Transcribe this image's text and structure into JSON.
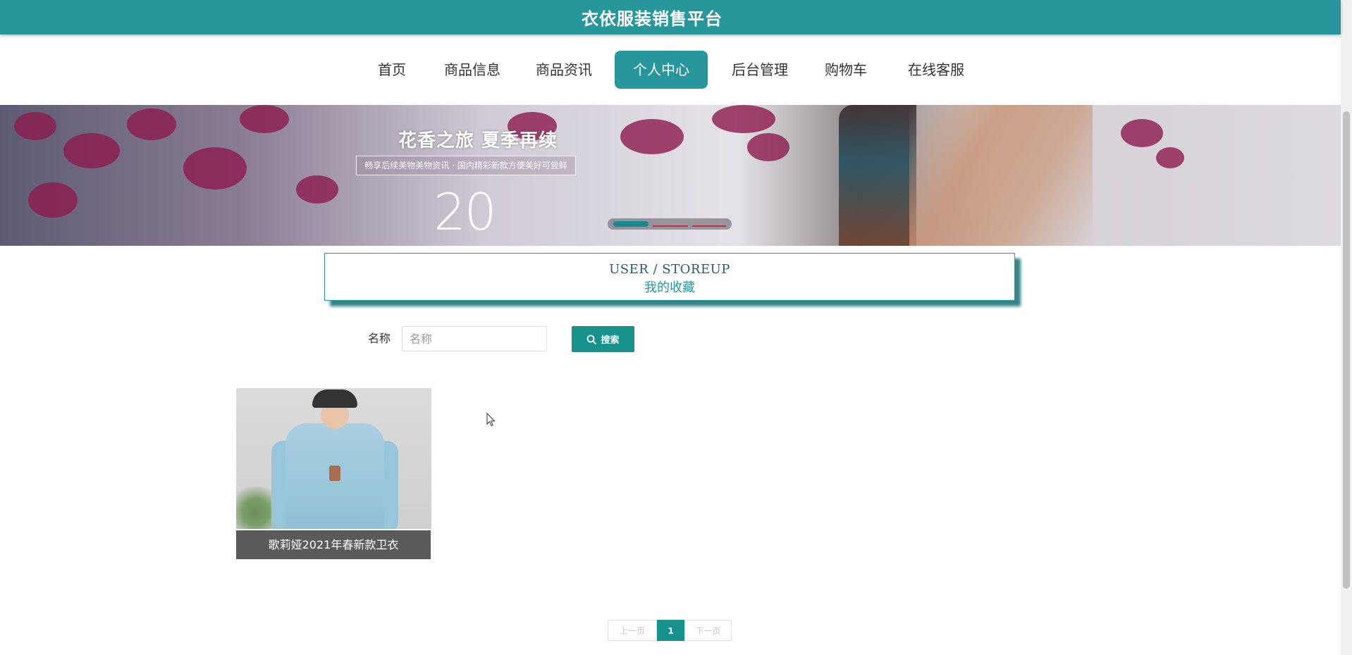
{
  "header": {
    "site_title": "衣依服装销售平台",
    "bg_color": "#27979c"
  },
  "nav": {
    "items": [
      {
        "label": "首页"
      },
      {
        "label": "商品信息"
      },
      {
        "label": "商品资讯"
      },
      {
        "label": "个人中心",
        "active": true
      },
      {
        "label": "后台管理"
      },
      {
        "label": "购物车"
      },
      {
        "label": "在线客服"
      }
    ]
  },
  "banner": {
    "headline": "花香之旅 夏季再续",
    "subline": "畅享后续美物美物资讯 · 国内精彩新款方便美好可尝鲜",
    "big_text": "20",
    "carousel": {
      "count": 3,
      "active_index": 0
    }
  },
  "section": {
    "en_title": "USER / STOREUP",
    "cn_title": "我的收藏"
  },
  "search": {
    "label": "名称",
    "placeholder": "名称",
    "value": "",
    "button_label": "搜索",
    "button_icon": "search-icon"
  },
  "products": [
    {
      "name": "歌莉娅2021年春新款卫衣"
    }
  ],
  "pagination": {
    "prev_label": "上一页",
    "current_page": "1",
    "next_label": "下一页"
  },
  "accent_color": "#17928b"
}
